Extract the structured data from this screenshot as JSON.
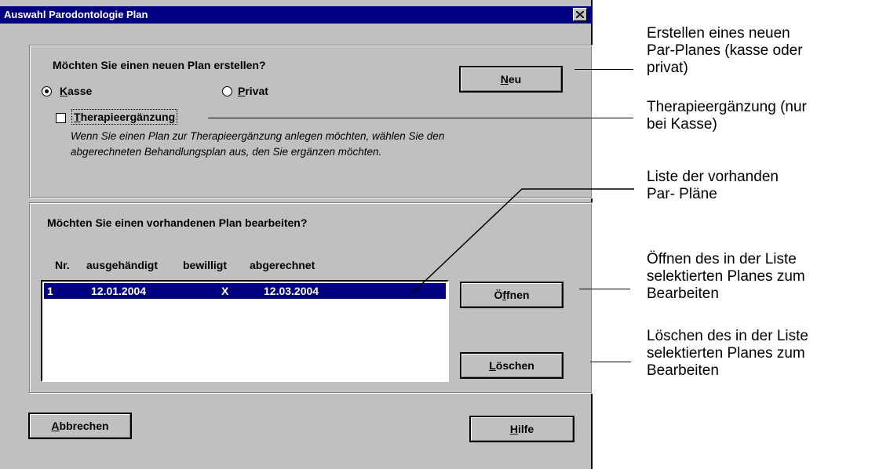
{
  "dialog": {
    "title": "Auswahl Parodontologie Plan"
  },
  "new_plan": {
    "question": "Möchten Sie einen neuen Plan erstellen?",
    "radio_kasse": "Kasse",
    "radio_privat": "Privat",
    "selected": "Kasse",
    "checkbox_label": "Therapieergänzung",
    "checkbox_checked": false,
    "hint_line1": "Wenn Sie einen Plan zur Therapieergänzung anlegen möchten, wählen Sie den",
    "hint_line2": "abgerechneten Behandlungsplan aus, den Sie ergänzen möchten.",
    "new_button": "Neu"
  },
  "existing_plan": {
    "question": "Möchten Sie einen vorhandenen Plan bearbeiten?",
    "columns": [
      "Nr.",
      "ausgehändigt",
      "bewilligt",
      "abgerechnet"
    ],
    "rows": [
      {
        "nr": "1",
        "ausgehaendigt": "12.01.2004",
        "bewilligt": "X",
        "abgerechnet": "12.03.2004"
      }
    ],
    "open_button": "Öffnen",
    "delete_button": "Löschen"
  },
  "footer": {
    "cancel_button": "Abbrechen",
    "help_button": "Hilfe"
  },
  "annotations": {
    "a1_l1": "Erstellen eines neuen",
    "a1_l2": "Par-Planes (kasse oder",
    "a1_l3": "privat)",
    "a2_l1": "Therapieergänzung (nur",
    "a2_l2": "bei Kasse)",
    "a3_l1": "Liste der vorhanden",
    "a3_l2": "Par- Pläne",
    "a4_l1": "Öffnen des in der Liste",
    "a4_l2": "selektierten Planes zum",
    "a4_l3": "Bearbeiten",
    "a5_l1": "Löschen des in der Liste",
    "a5_l2": "selektierten Planes zum",
    "a5_l3": "Bearbeiten"
  }
}
